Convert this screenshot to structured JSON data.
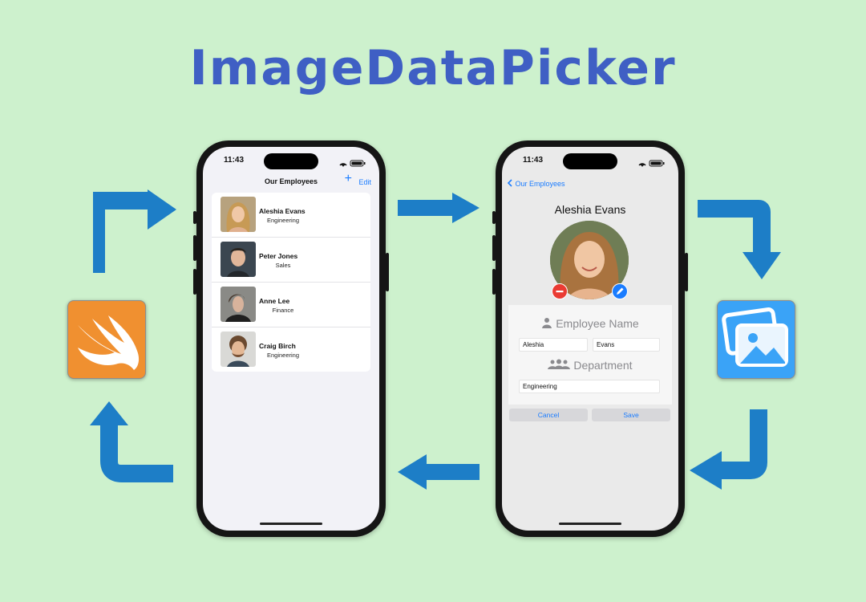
{
  "banner": {
    "title": "ImageDataPicker"
  },
  "colors": {
    "arrow": "#1d7ec7",
    "title": "#3f5fc4",
    "background": "#cdf1cd",
    "accent": "#1a7cff",
    "swift_orange": "#f09030",
    "photos_blue": "#3aa3f7"
  },
  "icons": {
    "left_app": "swift-logo-icon",
    "right_app": "photos-icon"
  },
  "list_screen": {
    "status_time": "11:43",
    "title": "Our Employees",
    "add_icon": "+",
    "edit_label": "Edit",
    "employees": [
      {
        "name": "Aleshia Evans",
        "department": "Engineering"
      },
      {
        "name": "Peter Jones",
        "department": "Sales"
      },
      {
        "name": "Anne Lee",
        "department": "Finance"
      },
      {
        "name": "Craig Birch",
        "department": "Engineering"
      }
    ]
  },
  "detail_screen": {
    "status_time": "11:43",
    "back_label": "Our Employees",
    "name": "Aleshia Evans",
    "employee_name_header": "Employee Name",
    "first_name": "Aleshia",
    "last_name": "Evans",
    "department_header": "Department",
    "department": "Engineering",
    "cancel_label": "Cancel",
    "save_label": "Save"
  }
}
